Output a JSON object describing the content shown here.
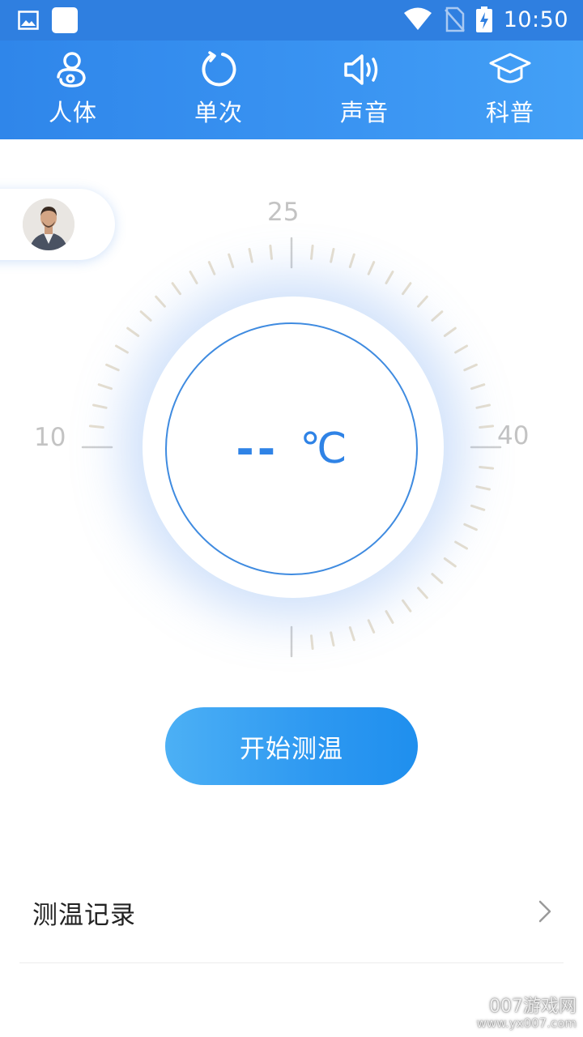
{
  "status_bar": {
    "time": "10:50",
    "icons": [
      "gallery-icon",
      "app-square-icon",
      "wifi-icon",
      "no-sim-icon",
      "battery-charging-icon"
    ]
  },
  "tabs": [
    {
      "label": "人体",
      "icon": "body-icon"
    },
    {
      "label": "单次",
      "icon": "refresh-circle-icon"
    },
    {
      "label": "声音",
      "icon": "speaker-icon"
    },
    {
      "label": "科普",
      "icon": "graduation-cap-icon"
    }
  ],
  "gauge": {
    "tick_labels": {
      "min": "10",
      "mid": "25",
      "max": "40"
    },
    "reading": "--",
    "unit": "℃"
  },
  "start_button": {
    "label": "开始测温"
  },
  "records": {
    "label": "测温记录"
  },
  "watermark": {
    "line1": "007游戏网",
    "line2": "www.yx007.com"
  },
  "colors": {
    "primary": "#2f86ea",
    "reading": "#2f83e6",
    "button_start": "#4cb0f5",
    "button_end": "#1f8fee"
  }
}
